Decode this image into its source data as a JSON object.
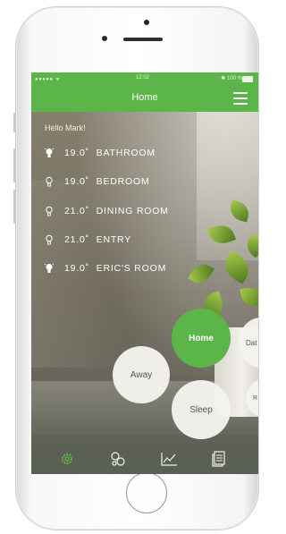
{
  "status_bar": {
    "carrier": "●●●●● ᯤ",
    "time": "12:02",
    "battery": "✱ 100 %"
  },
  "nav": {
    "title": "Home"
  },
  "greeting": "Hello Mark!",
  "rooms": [
    {
      "temp": "19.0˚",
      "name": "BATHROOM",
      "icon": "lightbulb-on-icon"
    },
    {
      "temp": "19.0˚",
      "name": "BEDROOM",
      "icon": "lightbulb-off-icon"
    },
    {
      "temp": "21.0˚",
      "name": "DINING ROOM",
      "icon": "lightbulb-off-icon"
    },
    {
      "temp": "21.0˚",
      "name": "ENTRY",
      "icon": "lightbulb-off-icon"
    },
    {
      "temp": "19.0˚",
      "name": "ERIC'S ROOM",
      "icon": "lightbulb-on-icon"
    }
  ],
  "modes": {
    "home": "Home",
    "away": "Away",
    "sleep": "Sleep",
    "date": "Dat",
    "r": "R"
  },
  "tabs": [
    "settings-gear-icon",
    "scenes-icon",
    "chart-icon",
    "log-icon"
  ],
  "colors": {
    "accent": "#5cb548",
    "bubble": "#f4f3ee",
    "text_dark": "#555555"
  }
}
